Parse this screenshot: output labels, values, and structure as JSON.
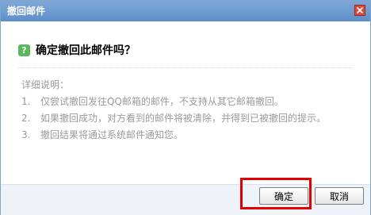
{
  "dialog": {
    "title": "撤回邮件",
    "close_icon": "close-x-icon",
    "question_icon": "question-icon",
    "question_glyph": "?",
    "question": "确定撤回此邮件吗？",
    "details_heading": "详细说明：",
    "details": [
      {
        "num": "1.",
        "text": "仅尝试撤回发往QQ邮箱的邮件，不支持从其它邮箱撤回。"
      },
      {
        "num": "2.",
        "text": "如果撤回成功，对方看到的邮件将被清除，并得到已被撤回的提示。"
      },
      {
        "num": "3.",
        "text": "撤回结果将通过系统邮件通知您。"
      }
    ],
    "buttons": {
      "ok_label": "确定",
      "cancel_label": "取消"
    }
  },
  "colors": {
    "titlebar": "#6a98d0",
    "close_button": "#d94b3c",
    "question_icon": "#5cb85c",
    "highlight_box": "#e00000"
  }
}
